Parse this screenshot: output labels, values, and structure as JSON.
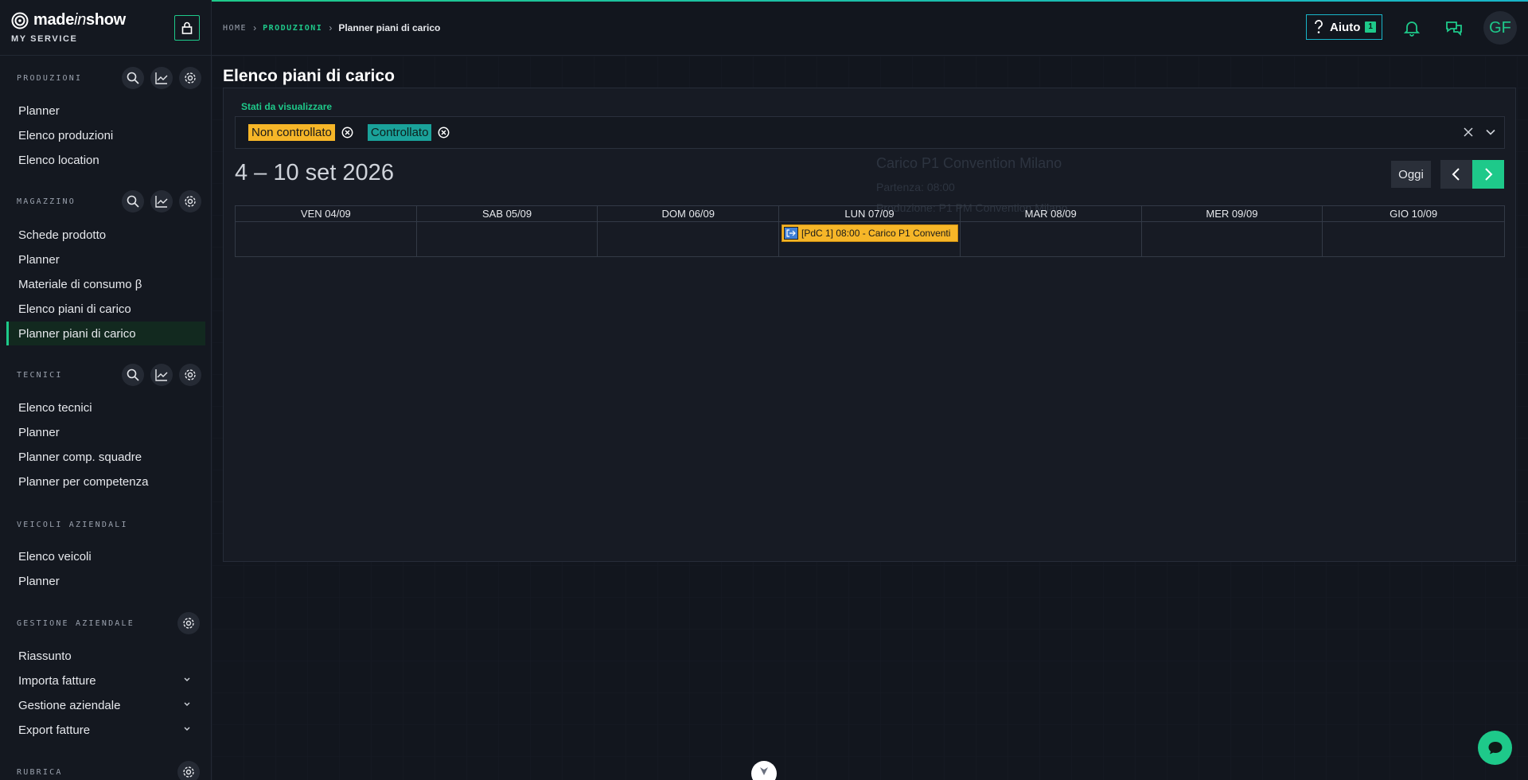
{
  "brand": {
    "name_main": "made",
    "name_italic": "in",
    "name_end": "show",
    "sub": "MY SERVICE"
  },
  "breadcrumb": {
    "home": "HOME",
    "section": "PRODUZIONI",
    "current": "Planner piani di carico",
    "sep": "›"
  },
  "header": {
    "help_label": "Aiuto",
    "help_badge": "1",
    "avatar": "GF"
  },
  "sidebar": {
    "produzioni": {
      "title": "PRODUZIONI",
      "items": [
        "Planner",
        "Elenco produzioni",
        "Elenco location"
      ]
    },
    "magazzino": {
      "title": "MAGAZZINO",
      "items": [
        "Schede prodotto",
        "Planner",
        "Materiale di consumo β",
        "Elenco piani di carico",
        "Planner piani di carico"
      ]
    },
    "tecnici": {
      "title": "TECNICI",
      "items": [
        "Elenco tecnici",
        "Planner",
        "Planner comp. squadre",
        "Planner per competenza"
      ]
    },
    "veicoli": {
      "title": "VEICOLI AZIENDALI",
      "items": [
        "Elenco veicoli",
        "Planner"
      ]
    },
    "gestione": {
      "title": "GESTIONE AZIENDALE",
      "items": [
        "Riassunto",
        "Importa fatture",
        "Gestione aziendale",
        "Export fatture"
      ]
    },
    "rubrica": {
      "title": "RUBRICA"
    }
  },
  "main": {
    "title": "Elenco piani di carico",
    "filter_label": "Stati da visualizzare",
    "tags": [
      "Non controllato",
      "Controllato"
    ],
    "date_range": "4 – 10 set 2026",
    "today": "Oggi",
    "ghost": {
      "title": "Carico P1 Convention Milano",
      "line1": "Partenza: 08:00",
      "line2": "Produzione: P1 PM Convention Milano"
    },
    "days": [
      "VEN 04/09",
      "SAB 05/09",
      "DOM 06/09",
      "LUN 07/09",
      "MAR 08/09",
      "MER 09/09",
      "GIO 10/09"
    ],
    "event": {
      "label": "[PdC 1] 08:00 - Carico P1 Conventi"
    }
  },
  "colors": {
    "accent": "#1ec98a",
    "tag_yellow": "#f6b628",
    "tag_teal": "#1aa29a",
    "event_icon": "#3f7fd6"
  }
}
